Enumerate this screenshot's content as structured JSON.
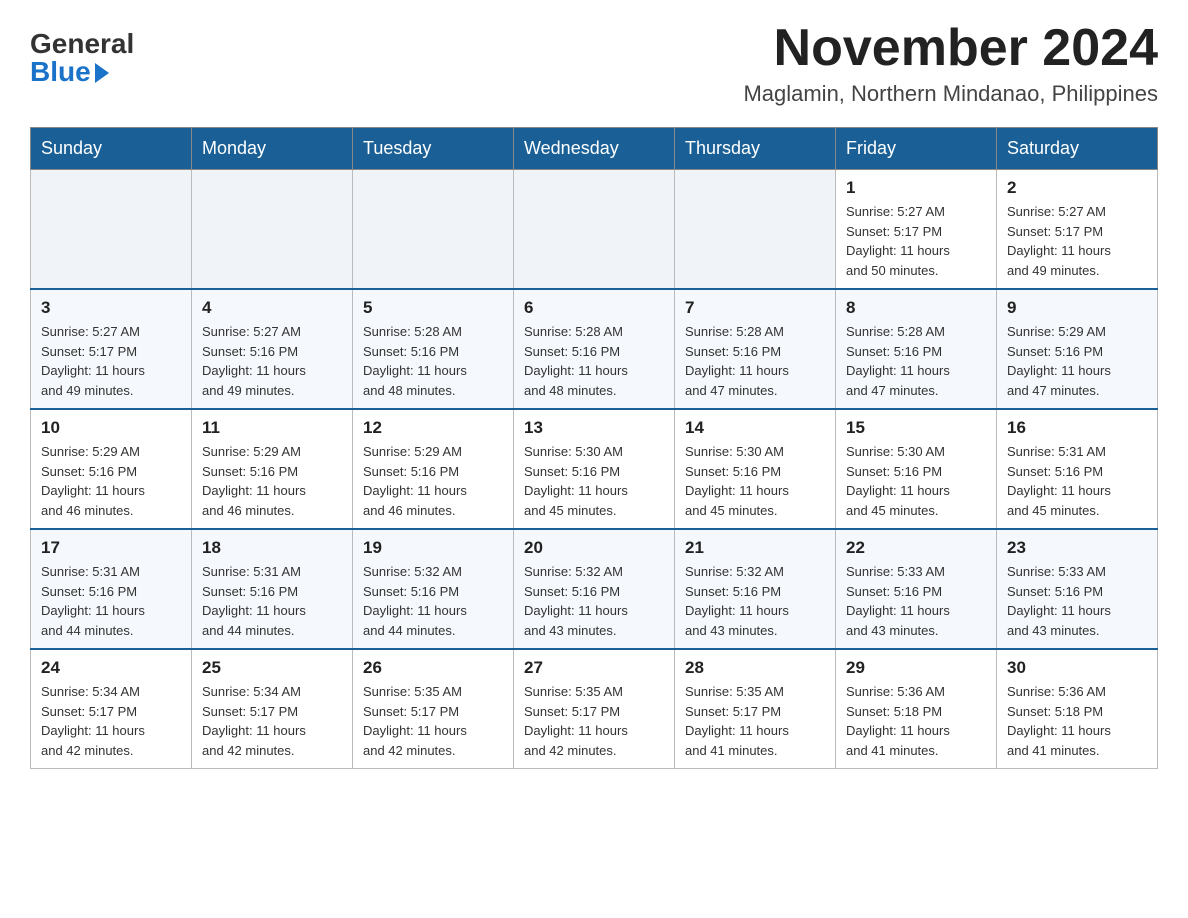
{
  "logo": {
    "general": "General",
    "blue": "Blue"
  },
  "title": "November 2024",
  "location": "Maglamin, Northern Mindanao, Philippines",
  "days_of_week": [
    "Sunday",
    "Monday",
    "Tuesday",
    "Wednesday",
    "Thursday",
    "Friday",
    "Saturday"
  ],
  "weeks": [
    [
      {
        "day": "",
        "info": ""
      },
      {
        "day": "",
        "info": ""
      },
      {
        "day": "",
        "info": ""
      },
      {
        "day": "",
        "info": ""
      },
      {
        "day": "",
        "info": ""
      },
      {
        "day": "1",
        "info": "Sunrise: 5:27 AM\nSunset: 5:17 PM\nDaylight: 11 hours\nand 50 minutes."
      },
      {
        "day": "2",
        "info": "Sunrise: 5:27 AM\nSunset: 5:17 PM\nDaylight: 11 hours\nand 49 minutes."
      }
    ],
    [
      {
        "day": "3",
        "info": "Sunrise: 5:27 AM\nSunset: 5:17 PM\nDaylight: 11 hours\nand 49 minutes."
      },
      {
        "day": "4",
        "info": "Sunrise: 5:27 AM\nSunset: 5:16 PM\nDaylight: 11 hours\nand 49 minutes."
      },
      {
        "day": "5",
        "info": "Sunrise: 5:28 AM\nSunset: 5:16 PM\nDaylight: 11 hours\nand 48 minutes."
      },
      {
        "day": "6",
        "info": "Sunrise: 5:28 AM\nSunset: 5:16 PM\nDaylight: 11 hours\nand 48 minutes."
      },
      {
        "day": "7",
        "info": "Sunrise: 5:28 AM\nSunset: 5:16 PM\nDaylight: 11 hours\nand 47 minutes."
      },
      {
        "day": "8",
        "info": "Sunrise: 5:28 AM\nSunset: 5:16 PM\nDaylight: 11 hours\nand 47 minutes."
      },
      {
        "day": "9",
        "info": "Sunrise: 5:29 AM\nSunset: 5:16 PM\nDaylight: 11 hours\nand 47 minutes."
      }
    ],
    [
      {
        "day": "10",
        "info": "Sunrise: 5:29 AM\nSunset: 5:16 PM\nDaylight: 11 hours\nand 46 minutes."
      },
      {
        "day": "11",
        "info": "Sunrise: 5:29 AM\nSunset: 5:16 PM\nDaylight: 11 hours\nand 46 minutes."
      },
      {
        "day": "12",
        "info": "Sunrise: 5:29 AM\nSunset: 5:16 PM\nDaylight: 11 hours\nand 46 minutes."
      },
      {
        "day": "13",
        "info": "Sunrise: 5:30 AM\nSunset: 5:16 PM\nDaylight: 11 hours\nand 45 minutes."
      },
      {
        "day": "14",
        "info": "Sunrise: 5:30 AM\nSunset: 5:16 PM\nDaylight: 11 hours\nand 45 minutes."
      },
      {
        "day": "15",
        "info": "Sunrise: 5:30 AM\nSunset: 5:16 PM\nDaylight: 11 hours\nand 45 minutes."
      },
      {
        "day": "16",
        "info": "Sunrise: 5:31 AM\nSunset: 5:16 PM\nDaylight: 11 hours\nand 45 minutes."
      }
    ],
    [
      {
        "day": "17",
        "info": "Sunrise: 5:31 AM\nSunset: 5:16 PM\nDaylight: 11 hours\nand 44 minutes."
      },
      {
        "day": "18",
        "info": "Sunrise: 5:31 AM\nSunset: 5:16 PM\nDaylight: 11 hours\nand 44 minutes."
      },
      {
        "day": "19",
        "info": "Sunrise: 5:32 AM\nSunset: 5:16 PM\nDaylight: 11 hours\nand 44 minutes."
      },
      {
        "day": "20",
        "info": "Sunrise: 5:32 AM\nSunset: 5:16 PM\nDaylight: 11 hours\nand 43 minutes."
      },
      {
        "day": "21",
        "info": "Sunrise: 5:32 AM\nSunset: 5:16 PM\nDaylight: 11 hours\nand 43 minutes."
      },
      {
        "day": "22",
        "info": "Sunrise: 5:33 AM\nSunset: 5:16 PM\nDaylight: 11 hours\nand 43 minutes."
      },
      {
        "day": "23",
        "info": "Sunrise: 5:33 AM\nSunset: 5:16 PM\nDaylight: 11 hours\nand 43 minutes."
      }
    ],
    [
      {
        "day": "24",
        "info": "Sunrise: 5:34 AM\nSunset: 5:17 PM\nDaylight: 11 hours\nand 42 minutes."
      },
      {
        "day": "25",
        "info": "Sunrise: 5:34 AM\nSunset: 5:17 PM\nDaylight: 11 hours\nand 42 minutes."
      },
      {
        "day": "26",
        "info": "Sunrise: 5:35 AM\nSunset: 5:17 PM\nDaylight: 11 hours\nand 42 minutes."
      },
      {
        "day": "27",
        "info": "Sunrise: 5:35 AM\nSunset: 5:17 PM\nDaylight: 11 hours\nand 42 minutes."
      },
      {
        "day": "28",
        "info": "Sunrise: 5:35 AM\nSunset: 5:17 PM\nDaylight: 11 hours\nand 41 minutes."
      },
      {
        "day": "29",
        "info": "Sunrise: 5:36 AM\nSunset: 5:18 PM\nDaylight: 11 hours\nand 41 minutes."
      },
      {
        "day": "30",
        "info": "Sunrise: 5:36 AM\nSunset: 5:18 PM\nDaylight: 11 hours\nand 41 minutes."
      }
    ]
  ]
}
